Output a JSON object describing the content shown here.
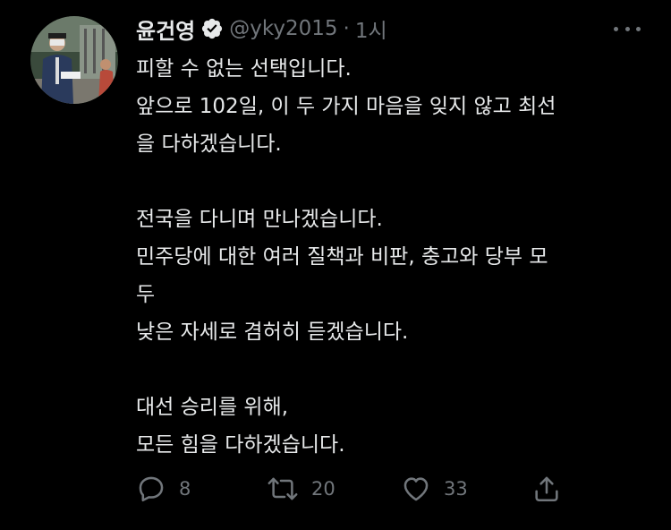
{
  "tweet": {
    "display_name": "윤건영",
    "handle": "@yky2015",
    "separator": "·",
    "time": "1시",
    "verified_icon": "verified-badge-icon",
    "lines": [
      "피할 수 없는 선택입니다.",
      "앞으로 102일, 이 두 가지 마음을 잊지 않고 최선",
      "을 다하겠습니다.",
      "",
      "전국을 다니며 만나겠습니다.",
      "민주당에 대한 여러 질책과 비판, 충고와 당부 모",
      "두",
      "낮은 자세로 겸허히 듣겠습니다.",
      "",
      "대선 승리를 위해,",
      "모든 힘을 다하겠습니다."
    ],
    "actions": {
      "reply_count": "8",
      "retweet_count": "20",
      "like_count": "33"
    }
  },
  "colors": {
    "background": "#000000",
    "text_primary": "#e7e9ea",
    "text_secondary": "#71767b"
  }
}
